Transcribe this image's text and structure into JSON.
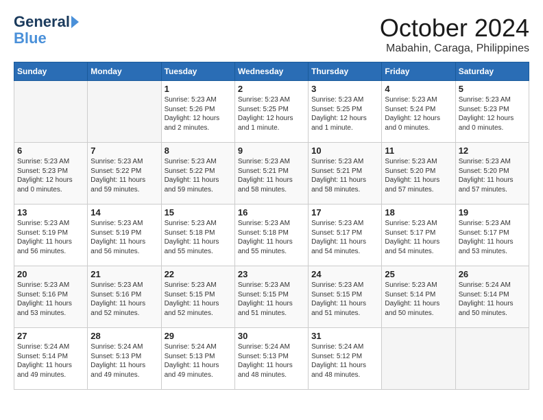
{
  "header": {
    "logo_line1": "General",
    "logo_line2": "Blue",
    "month": "October 2024",
    "location": "Mabahin, Caraga, Philippines"
  },
  "calendar": {
    "weekdays": [
      "Sunday",
      "Monday",
      "Tuesday",
      "Wednesday",
      "Thursday",
      "Friday",
      "Saturday"
    ],
    "weeks": [
      [
        {
          "day": "",
          "empty": true
        },
        {
          "day": "",
          "empty": true
        },
        {
          "day": "1",
          "sunrise": "5:23 AM",
          "sunset": "5:26 PM",
          "daylight": "12 hours and 2 minutes."
        },
        {
          "day": "2",
          "sunrise": "5:23 AM",
          "sunset": "5:25 PM",
          "daylight": "12 hours and 1 minute."
        },
        {
          "day": "3",
          "sunrise": "5:23 AM",
          "sunset": "5:25 PM",
          "daylight": "12 hours and 1 minute."
        },
        {
          "day": "4",
          "sunrise": "5:23 AM",
          "sunset": "5:24 PM",
          "daylight": "12 hours and 0 minutes."
        },
        {
          "day": "5",
          "sunrise": "5:23 AM",
          "sunset": "5:23 PM",
          "daylight": "12 hours and 0 minutes."
        }
      ],
      [
        {
          "day": "6",
          "sunrise": "5:23 AM",
          "sunset": "5:23 PM",
          "daylight": "12 hours and 0 minutes."
        },
        {
          "day": "7",
          "sunrise": "5:23 AM",
          "sunset": "5:22 PM",
          "daylight": "11 hours and 59 minutes."
        },
        {
          "day": "8",
          "sunrise": "5:23 AM",
          "sunset": "5:22 PM",
          "daylight": "11 hours and 59 minutes."
        },
        {
          "day": "9",
          "sunrise": "5:23 AM",
          "sunset": "5:21 PM",
          "daylight": "11 hours and 58 minutes."
        },
        {
          "day": "10",
          "sunrise": "5:23 AM",
          "sunset": "5:21 PM",
          "daylight": "11 hours and 58 minutes."
        },
        {
          "day": "11",
          "sunrise": "5:23 AM",
          "sunset": "5:20 PM",
          "daylight": "11 hours and 57 minutes."
        },
        {
          "day": "12",
          "sunrise": "5:23 AM",
          "sunset": "5:20 PM",
          "daylight": "11 hours and 57 minutes."
        }
      ],
      [
        {
          "day": "13",
          "sunrise": "5:23 AM",
          "sunset": "5:19 PM",
          "daylight": "11 hours and 56 minutes."
        },
        {
          "day": "14",
          "sunrise": "5:23 AM",
          "sunset": "5:19 PM",
          "daylight": "11 hours and 56 minutes."
        },
        {
          "day": "15",
          "sunrise": "5:23 AM",
          "sunset": "5:18 PM",
          "daylight": "11 hours and 55 minutes."
        },
        {
          "day": "16",
          "sunrise": "5:23 AM",
          "sunset": "5:18 PM",
          "daylight": "11 hours and 55 minutes."
        },
        {
          "day": "17",
          "sunrise": "5:23 AM",
          "sunset": "5:17 PM",
          "daylight": "11 hours and 54 minutes."
        },
        {
          "day": "18",
          "sunrise": "5:23 AM",
          "sunset": "5:17 PM",
          "daylight": "11 hours and 54 minutes."
        },
        {
          "day": "19",
          "sunrise": "5:23 AM",
          "sunset": "5:17 PM",
          "daylight": "11 hours and 53 minutes."
        }
      ],
      [
        {
          "day": "20",
          "sunrise": "5:23 AM",
          "sunset": "5:16 PM",
          "daylight": "11 hours and 53 minutes."
        },
        {
          "day": "21",
          "sunrise": "5:23 AM",
          "sunset": "5:16 PM",
          "daylight": "11 hours and 52 minutes."
        },
        {
          "day": "22",
          "sunrise": "5:23 AM",
          "sunset": "5:15 PM",
          "daylight": "11 hours and 52 minutes."
        },
        {
          "day": "23",
          "sunrise": "5:23 AM",
          "sunset": "5:15 PM",
          "daylight": "11 hours and 51 minutes."
        },
        {
          "day": "24",
          "sunrise": "5:23 AM",
          "sunset": "5:15 PM",
          "daylight": "11 hours and 51 minutes."
        },
        {
          "day": "25",
          "sunrise": "5:23 AM",
          "sunset": "5:14 PM",
          "daylight": "11 hours and 50 minutes."
        },
        {
          "day": "26",
          "sunrise": "5:24 AM",
          "sunset": "5:14 PM",
          "daylight": "11 hours and 50 minutes."
        }
      ],
      [
        {
          "day": "27",
          "sunrise": "5:24 AM",
          "sunset": "5:14 PM",
          "daylight": "11 hours and 49 minutes."
        },
        {
          "day": "28",
          "sunrise": "5:24 AM",
          "sunset": "5:13 PM",
          "daylight": "11 hours and 49 minutes."
        },
        {
          "day": "29",
          "sunrise": "5:24 AM",
          "sunset": "5:13 PM",
          "daylight": "11 hours and 49 minutes."
        },
        {
          "day": "30",
          "sunrise": "5:24 AM",
          "sunset": "5:13 PM",
          "daylight": "11 hours and 48 minutes."
        },
        {
          "day": "31",
          "sunrise": "5:24 AM",
          "sunset": "5:12 PM",
          "daylight": "11 hours and 48 minutes."
        },
        {
          "day": "",
          "empty": true
        },
        {
          "day": "",
          "empty": true
        }
      ]
    ]
  }
}
